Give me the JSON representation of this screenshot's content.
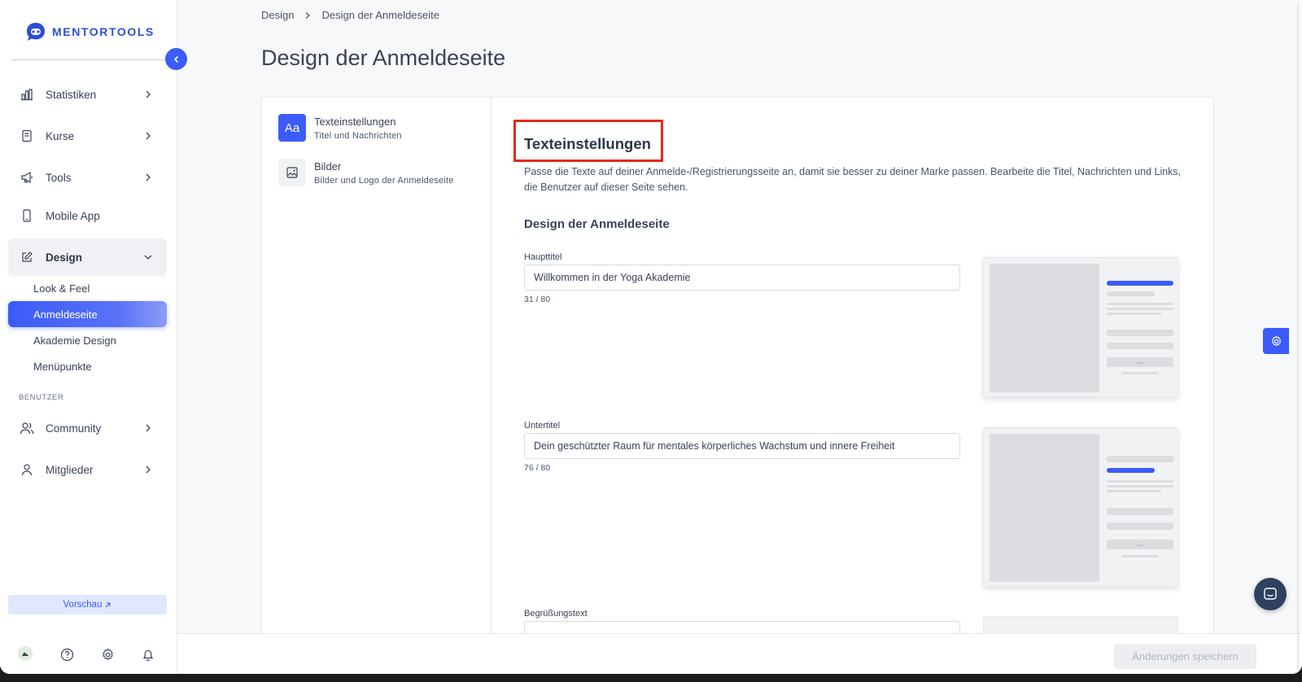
{
  "app": {
    "brand": "MENTORTOOLS"
  },
  "sidebar": {
    "items": [
      {
        "label": "Statistiken",
        "icon": "bar-chart-icon"
      },
      {
        "label": "Kurse",
        "icon": "book-icon"
      },
      {
        "label": "Tools",
        "icon": "megaphone-icon"
      },
      {
        "label": "Mobile App",
        "icon": "phone-icon"
      },
      {
        "label": "Design",
        "icon": "edit-icon"
      }
    ],
    "design_sub": [
      {
        "label": "Look & Feel"
      },
      {
        "label": "Anmeldeseite"
      },
      {
        "label": "Akademie Design"
      },
      {
        "label": "Menüpunkte"
      }
    ],
    "section_users": "BENUTZER",
    "user_items": [
      {
        "label": "Community",
        "icon": "users-icon"
      },
      {
        "label": "Mitglieder",
        "icon": "user-icon"
      }
    ],
    "preview": "Vorschau"
  },
  "breadcrumb": {
    "parent": "Design",
    "current": "Design der Anmeldeseite"
  },
  "page": {
    "title": "Design der Anmeldeseite"
  },
  "tabs": [
    {
      "title": "Texteinstellungen",
      "subtitle": "Titel und Nachrichten"
    },
    {
      "title": "Bilder",
      "subtitle": "Bilder und Logo der Anmeldeseite"
    }
  ],
  "content": {
    "title": "Texteinstellungen",
    "description": "Passe die Texte auf deiner Anmelde-/Registrierungsseite an, damit sie besser zu deiner Marke passen. Bearbeite die Titel, Nachrichten und Links, die Benutzer auf dieser Seite sehen.",
    "section": "Design der Anmeldeseite",
    "fields": [
      {
        "label": "Haupttitel",
        "value": "Willkommen in der Yoga Akademie",
        "count": "31 / 80"
      },
      {
        "label": "Untertitel",
        "value": "Dein geschützter Raum für mentales körperliches Wachstum und innere Freiheit",
        "count": "76 / 80"
      },
      {
        "label": "Begrüßungstext"
      }
    ],
    "mock_button": "Log in"
  },
  "footer": {
    "save": "Änderungen speichern"
  },
  "colors": {
    "accent": "#3b5bfa",
    "highlight": "#e8281a"
  }
}
